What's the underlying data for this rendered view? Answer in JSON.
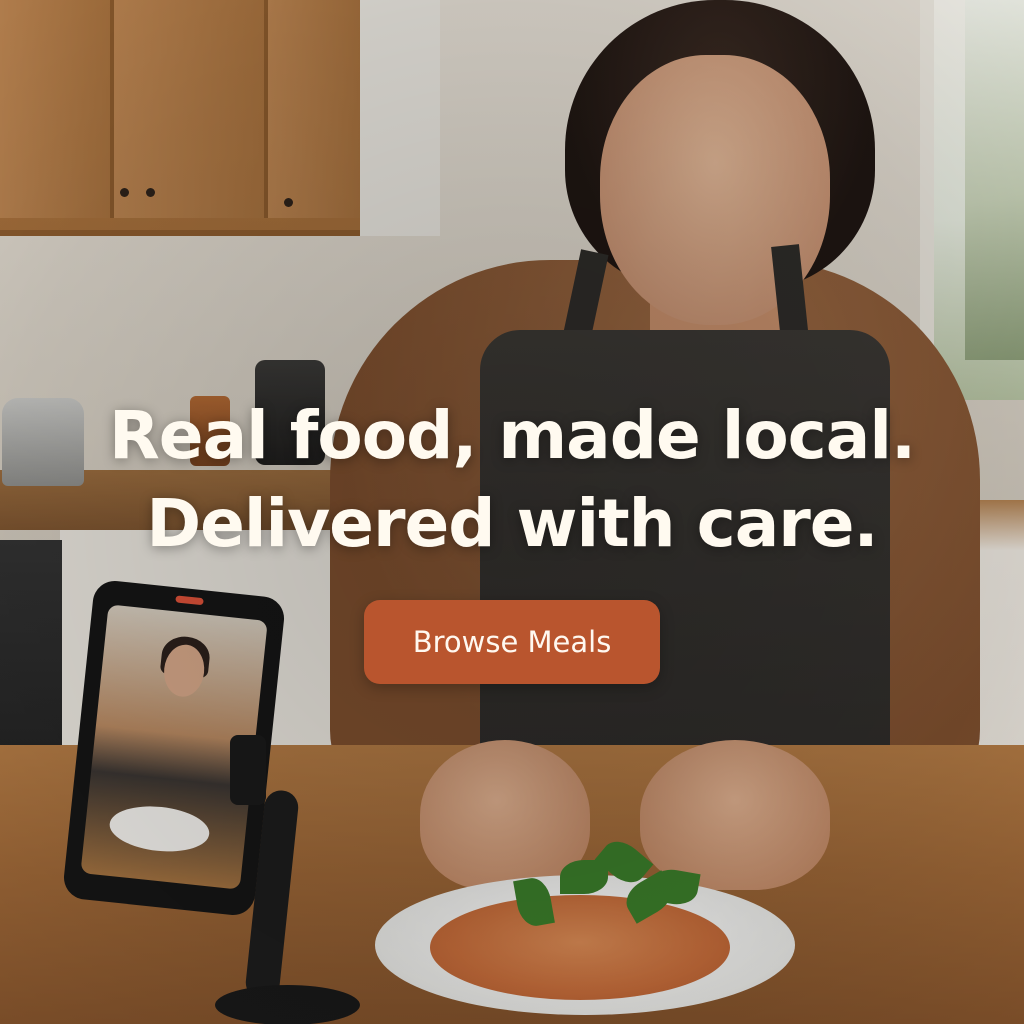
{
  "hero": {
    "headline_line1": "Real food, made local.",
    "headline_line2": "Delivered with care.",
    "cta_label": "Browse Meals",
    "cta_color": "#b9552e",
    "headline_color": "#fffaf0"
  }
}
